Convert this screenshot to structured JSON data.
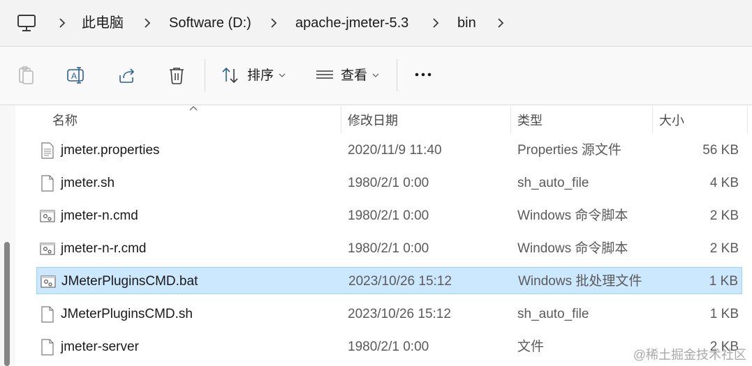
{
  "breadcrumb": {
    "items": [
      "此电脑",
      "Software (D:)",
      "apache-jmeter-5.3",
      "bin"
    ]
  },
  "toolbar": {
    "sort_label": "排序",
    "view_label": "查看"
  },
  "columns": {
    "name": "名称",
    "date": "修改日期",
    "type": "类型",
    "size": "大小"
  },
  "files": [
    {
      "name": "jmeter.properties",
      "date": "2020/11/9 11:40",
      "type": "Properties 源文件",
      "size": "56 KB",
      "icon": "properties-file-icon",
      "selected": false
    },
    {
      "name": "jmeter.sh",
      "date": "1980/2/1 0:00",
      "type": "sh_auto_file",
      "size": "4 KB",
      "icon": "blank-file-icon",
      "selected": false
    },
    {
      "name": "jmeter-n.cmd",
      "date": "1980/2/1 0:00",
      "type": "Windows 命令脚本",
      "size": "2 KB",
      "icon": "script-file-icon",
      "selected": false
    },
    {
      "name": "jmeter-n-r.cmd",
      "date": "1980/2/1 0:00",
      "type": "Windows 命令脚本",
      "size": "2 KB",
      "icon": "script-file-icon",
      "selected": false
    },
    {
      "name": "JMeterPluginsCMD.bat",
      "date": "2023/10/26 15:12",
      "type": "Windows 批处理文件",
      "size": "1 KB",
      "icon": "script-file-icon",
      "selected": true
    },
    {
      "name": "JMeterPluginsCMD.sh",
      "date": "2023/10/26 15:12",
      "type": "sh_auto_file",
      "size": "1 KB",
      "icon": "blank-file-icon",
      "selected": false
    },
    {
      "name": "jmeter-server",
      "date": "1980/2/1 0:00",
      "type": "文件",
      "size": "2 KB",
      "icon": "blank-file-icon",
      "selected": false
    }
  ],
  "watermark": "@稀土掘金技术社区",
  "colors": {
    "selection_bg": "#cce8ff",
    "selection_border": "#99d1ff",
    "accent": "#0067c0"
  }
}
